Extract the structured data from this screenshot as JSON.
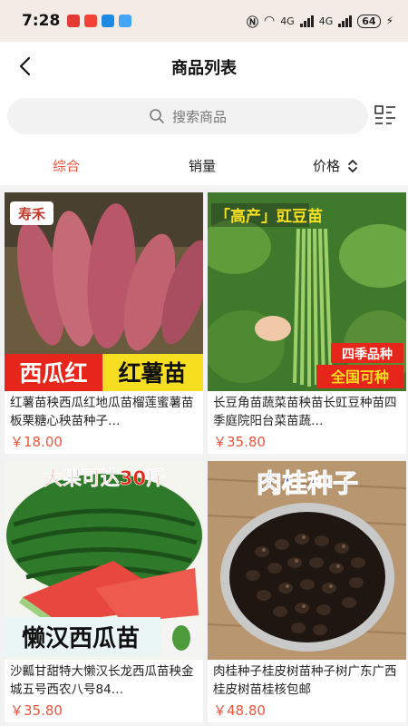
{
  "status_bar": {
    "time": "7:28",
    "battery": "64",
    "network_a": "4G",
    "network_b": "4G"
  },
  "header": {
    "title": "商品列表"
  },
  "search": {
    "placeholder": "搜索商品"
  },
  "sort_tabs": [
    {
      "label": "综合"
    },
    {
      "label": "销量"
    },
    {
      "label": "价格"
    }
  ],
  "products": [
    {
      "name": "红薯苗秧西瓜红地瓜苗榴莲蜜薯苗板栗糖心秧苗种子…",
      "price": "￥18.00",
      "image_text_a": "西瓜红",
      "image_text_b": "红薯苗",
      "image_brand": "寿禾"
    },
    {
      "name": "长豆角苗蔬菜苗秧苗长豇豆种苗四季庭院阳台菜苗蔬…",
      "price": "￥35.80",
      "image_text_a": "「高产」豇豆苗",
      "image_text_b": "四季品种",
      "image_text_c": "全国可种"
    },
    {
      "name": "沙瓤甘甜特大懒汉长龙西瓜苗秧金城五号西农八号84…",
      "price": "￥35.80",
      "image_text_a": "大果可达30斤",
      "image_text_b": "懒汉西瓜苗"
    },
    {
      "name": "肉桂种子桂皮树苗种子树广东广西桂皮树苗桂核包邮",
      "price": "￥48.80",
      "image_text_a": "肉桂种子"
    }
  ],
  "colors": {
    "accent": "#f0543a"
  }
}
